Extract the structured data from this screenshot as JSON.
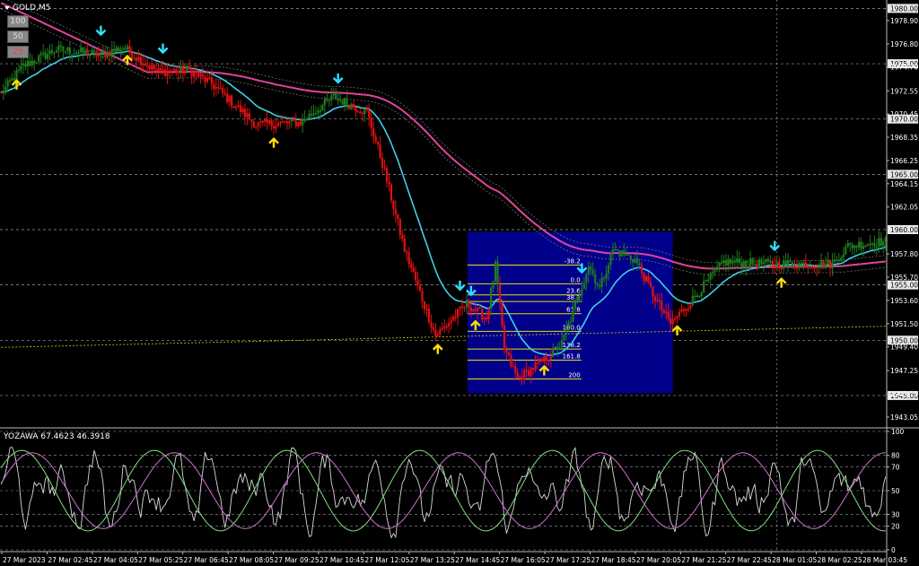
{
  "symbol_title": "GOLD,M5",
  "period_buttons": [
    "100",
    "50",
    "25"
  ],
  "colors": {
    "background": "#000000",
    "bull_bar": "#1f7a1f",
    "bear_bar": "#e01010",
    "fast_ma": "#40d0e8",
    "slow_ma": "#e0449c",
    "envelope": "#707070",
    "dotted_line": "#c8b400",
    "fib_box": "#00008b",
    "fib_line": "#e8e000",
    "up_arrow": "#ffe000",
    "down_arrow": "#30e0ff",
    "osc_white": "#d8d8d8",
    "osc_green": "#80e080",
    "osc_violet": "#d070d0",
    "axis_text": "#ffffff",
    "grid": "#9a9a9a"
  },
  "chart_data": [
    {
      "type": "candlestick",
      "price_axis_ticks": [
        "1980.00",
        "1978.90",
        "1976.80",
        "1975.00",
        "1974.70",
        "1972.55",
        "1970.45",
        "1970.00",
        "1968.35",
        "1966.25",
        "1965.00",
        "1964.15",
        "1962.05",
        "1960.00",
        "1957.80",
        "1955.70",
        "1955.00",
        "1953.60",
        "1951.50",
        "1950.00",
        "1949.40",
        "1947.25",
        "1945.00",
        "1945.15",
        "1943.05"
      ],
      "highlighted_levels": [
        "1980.00",
        "1975.00",
        "1970.00",
        "1965.00",
        "1960.00",
        "1955.00",
        "1950.00",
        "1945.00"
      ],
      "time_axis_labels": [
        "27 Mar 2023",
        "27 Mar 02:45",
        "27 Mar 04:05",
        "27 Mar 05:25",
        "27 Mar 06:45",
        "27 Mar 08:05",
        "27 Mar 09:25",
        "27 Mar 10:45",
        "27 Mar 12:05",
        "27 Mar 13:25",
        "27 Mar 14:45",
        "27 Mar 16:05",
        "27 Mar 17:25",
        "27 Mar 18:45",
        "27 Mar 20:05",
        "27 Mar 21:25",
        "27 Mar 22:45",
        "28 Mar 01:05",
        "28 Mar 02:25",
        "28 Mar 03:45"
      ],
      "ylim": [
        1942.4,
        1980.6
      ],
      "price_path": [
        [
          0,
          1972.3
        ],
        [
          10,
          1974.8
        ],
        [
          25,
          1976.3
        ],
        [
          45,
          1975.8
        ],
        [
          55,
          1976.5
        ],
        [
          70,
          1974.3
        ],
        [
          85,
          1974.4
        ],
        [
          95,
          1973.2
        ],
        [
          115,
          1969.5
        ],
        [
          135,
          1969.7
        ],
        [
          150,
          1972.0
        ],
        [
          165,
          1970.6
        ],
        [
          172,
          1966.0
        ],
        [
          182,
          1958.2
        ],
        [
          192,
          1952.6
        ],
        [
          196,
          1950.4
        ],
        [
          200,
          1951.2
        ],
        [
          210,
          1953.3
        ],
        [
          219,
          1952.0
        ],
        [
          223,
          1956.7
        ],
        [
          227,
          1949.2
        ],
        [
          233,
          1946.5
        ],
        [
          245,
          1948.2
        ],
        [
          253,
          1949.7
        ],
        [
          260,
          1953.7
        ],
        [
          265,
          1956.8
        ],
        [
          270,
          1954.7
        ],
        [
          276,
          1958.2
        ],
        [
          286,
          1957.3
        ],
        [
          295,
          1953.8
        ],
        [
          302,
          1951.5
        ],
        [
          312,
          1953.7
        ],
        [
          326,
          1957.1
        ],
        [
          345,
          1956.9
        ],
        [
          360,
          1956.9
        ],
        [
          375,
          1956.9
        ],
        [
          382,
          1958.5
        ],
        [
          395,
          1958.9
        ]
      ],
      "fib_levels": [
        {
          "label": "-38.2",
          "price": 1956.8
        },
        {
          "label": "0.0",
          "price": 1955.1
        },
        {
          "label": "23.6",
          "price": 1954.1
        },
        {
          "label": "38.2",
          "price": 1953.5
        },
        {
          "label": "61.8",
          "price": 1952.4
        },
        {
          "label": "100.0",
          "price": 1950.8
        },
        {
          "label": "138.2",
          "price": 1949.2
        },
        {
          "label": "161.8",
          "price": 1948.2
        },
        {
          "label": "200",
          "price": 1946.5
        }
      ],
      "up_arrow_bars": [
        7,
        57,
        123,
        197,
        214,
        245,
        305,
        352
      ],
      "down_arrow_bars": [
        45,
        73,
        152,
        207,
        212,
        262,
        349
      ]
    },
    {
      "type": "line",
      "title": "YOZAWA 67.4623 46.3918",
      "ylim": [
        0,
        100
      ],
      "y_ticks": [
        "100",
        "80",
        "70",
        "50",
        "30",
        "20",
        "0"
      ]
    }
  ]
}
